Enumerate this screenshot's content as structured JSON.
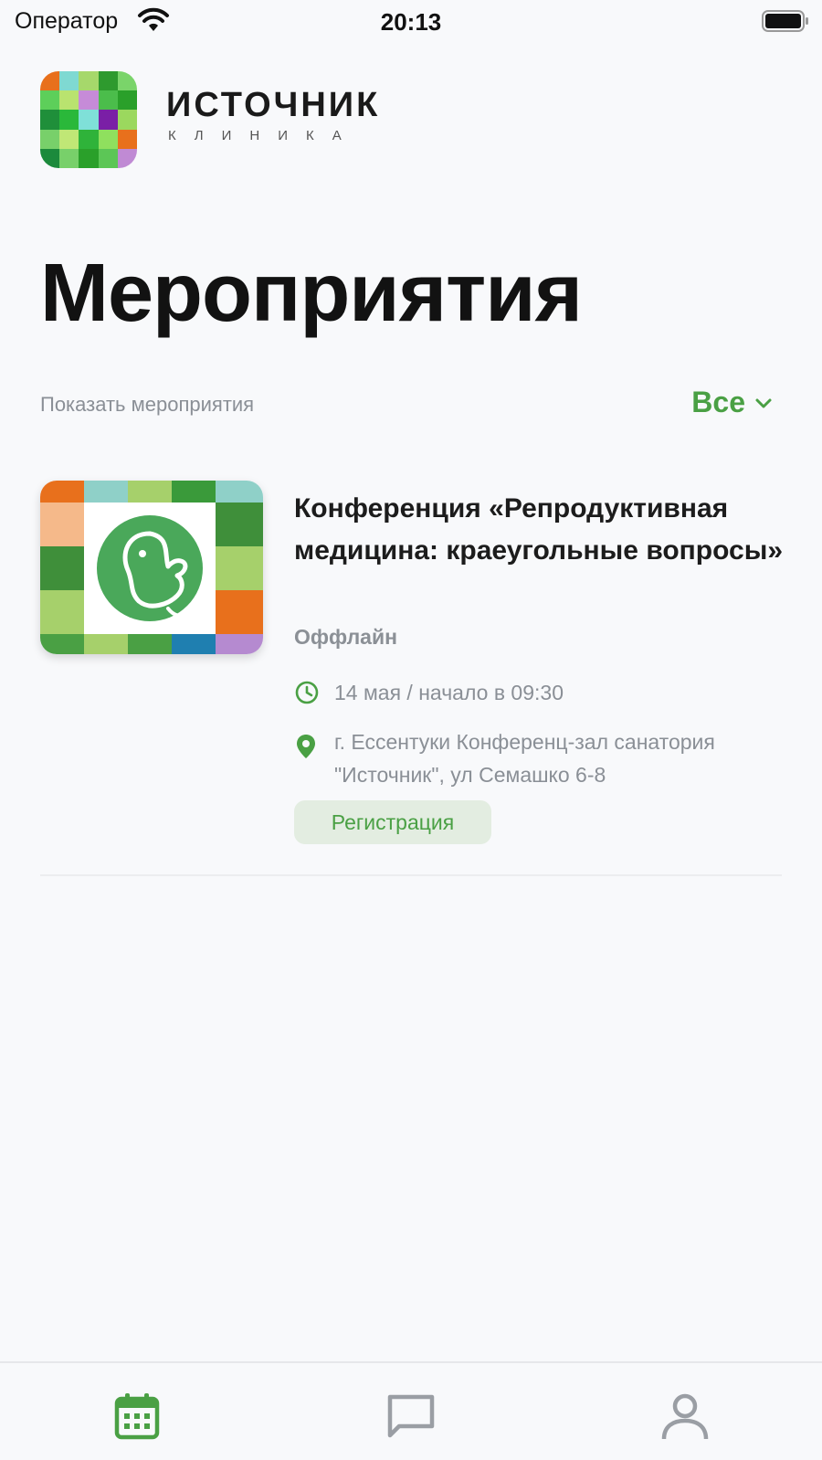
{
  "status_bar": {
    "carrier": "Оператор",
    "time": "20:13"
  },
  "brand": {
    "name": "ИСТОЧНИК",
    "subtitle": "КЛИНИКА"
  },
  "page_title": "Мероприятия",
  "filter": {
    "label": "Показать мероприятия",
    "selected": "Все"
  },
  "events": [
    {
      "title": "Конференция «Репродуктивная медицина: краеугольные вопросы»",
      "format": "Оффлайн",
      "date": "14 мая / начало в 09:30",
      "location": "г. Ессентуки Конференц-зал санатория \"Источник\", ул Семашко 6-8",
      "register_label": "Регистрация"
    }
  ],
  "tabs": [
    {
      "icon": "calendar-icon",
      "active": true
    },
    {
      "icon": "chat-icon",
      "active": false
    },
    {
      "icon": "profile-icon",
      "active": false
    }
  ],
  "colors": {
    "accent": "#4aa044",
    "inactive_icon": "#9a9ea4",
    "background": "#f8f9fb"
  }
}
